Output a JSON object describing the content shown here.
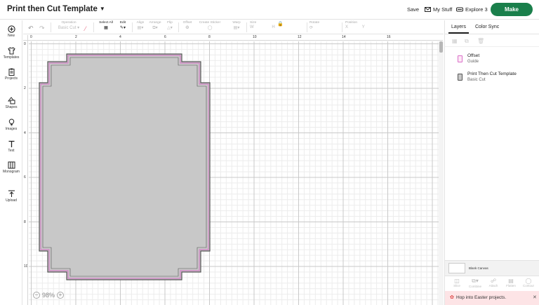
{
  "topbar": {
    "title": "Print then Cut Template",
    "save": "Save",
    "my_stuff": "My Stuff",
    "explore": "Explore 3",
    "make": "Make"
  },
  "left_tools": [
    {
      "label": "New",
      "icon": "plus-circle-icon"
    },
    {
      "label": "Templates",
      "icon": "shirt-icon"
    },
    {
      "label": "Projects",
      "icon": "clipboard-icon"
    },
    {
      "label": "Shapes",
      "icon": "shapes-icon"
    },
    {
      "label": "Images",
      "icon": "bulb-icon"
    },
    {
      "label": "Text",
      "icon": "text-icon"
    },
    {
      "label": "Monogram",
      "icon": "monogram-icon"
    },
    {
      "label": "Upload",
      "icon": "upload-icon"
    }
  ],
  "edit_toolbar": {
    "operation_label": "Operation",
    "operation_value": "Basic Cut",
    "select_all": "Select All",
    "edit": "Edit",
    "align": "Align",
    "arrange": "Arrange",
    "flip": "Flip",
    "offset": "Offset",
    "create_sticker": "Create Sticker",
    "warp": "Warp",
    "size": "Size",
    "size_w": "W",
    "size_h": "H",
    "rotate": "Rotate",
    "position": "Position",
    "pos_x": "X",
    "pos_y": "Y"
  },
  "rulers": {
    "h": [
      "0",
      "2",
      "4",
      "6",
      "8",
      "10",
      "12",
      "14",
      "16"
    ],
    "v": [
      "0",
      "2",
      "4",
      "6",
      "8",
      "10"
    ]
  },
  "zoom": {
    "value": "98%",
    "minus": "−",
    "plus": "+"
  },
  "right_panel": {
    "tabs": [
      "Layers",
      "Color Sync"
    ],
    "layers": [
      {
        "name": "Offset",
        "sub": "Guide",
        "color": "#f4d6ee",
        "border": "#d96fc8"
      },
      {
        "name": "Print Then Cut Template",
        "sub": "Basic Cut",
        "color": "#c8c8c8",
        "border": "#555555"
      }
    ],
    "blank_canvas": "Blank Canvas",
    "bottom_tools": [
      "Slice",
      "Combine",
      "Attach",
      "Flatten",
      "Contour"
    ],
    "promo": "Hop into Easter projects."
  },
  "colors": {
    "accent": "#1a7f4b",
    "shape_fill": "#c8c8c8",
    "offset_line": "#d96fc8",
    "promo_bg": "#fde4e6"
  }
}
